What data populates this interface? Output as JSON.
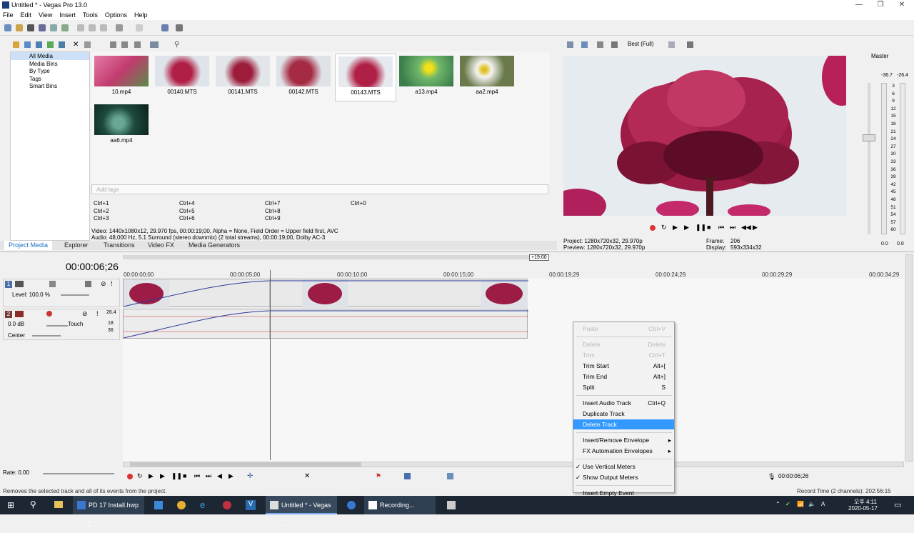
{
  "window": {
    "title": "Untitled * - Vegas Pro 13.0"
  },
  "menu": [
    "File",
    "Edit",
    "View",
    "Insert",
    "Tools",
    "Options",
    "Help"
  ],
  "explorer_tree": [
    "All Media",
    "Media Bins",
    "By Type",
    "Tags",
    "Smart Bins"
  ],
  "media": [
    {
      "name": "10.mp4",
      "color": "#c23b6e"
    },
    {
      "name": "00140.MTS",
      "color": "#a81e3c"
    },
    {
      "name": "00141.MTS",
      "color": "#9c1c3a"
    },
    {
      "name": "00142.MTS",
      "color": "#a52a44"
    },
    {
      "name": "00143.MTS",
      "color": "#b01f45"
    },
    {
      "name": "a13.mp4",
      "color": "#4e9a5a"
    },
    {
      "name": "aa2.mp4",
      "color": "#e8e6d8"
    },
    {
      "name": "aa6.mp4",
      "color": "#1d4a3e"
    }
  ],
  "tags_placeholder": "Add tags",
  "shortcuts": [
    [
      "Ctrl+1",
      "Ctrl+4",
      "Ctrl+7",
      "Ctrl+0"
    ],
    [
      "Ctrl+2",
      "Ctrl+5",
      "Ctrl+8"
    ],
    [
      "Ctrl+3",
      "Ctrl+6",
      "Ctrl+9"
    ]
  ],
  "media_info": {
    "video": "Video: 1440x1080x12, 29.970 fps, 00:00:19;00, Alpha = None, Field Order = Upper field first, AVC",
    "audio": "Audio: 48,000 Hz, 5.1 Surround (stereo downmix) (2 total streams), 00:00:19;00, Dolby AC-3"
  },
  "tabs": [
    "Project Media",
    "Explorer",
    "Transitions",
    "Video FX",
    "Media Generators"
  ],
  "preview": {
    "quality": "Best (Full)",
    "project": "Project:  1280x720x32, 29.970p",
    "preview": "Preview:  1280x720x32, 29.970p",
    "frame_label": "Frame:",
    "frame_value": "206",
    "display_label": "Display:",
    "display_value": "593x334x32"
  },
  "master": {
    "label": "Master",
    "peak_left": "-36.7",
    "peak_right": "-26.4",
    "scale": [
      "3",
      "6",
      "9",
      "12",
      "15",
      "18",
      "21",
      "24",
      "27",
      "30",
      "33",
      "36",
      "39",
      "42",
      "45",
      "48",
      "51",
      "54",
      "57",
      "60"
    ],
    "bottom_left": "0.0",
    "bottom_right": "0.0"
  },
  "timeline": {
    "current_time": "00:00:06;26",
    "end_marker": "+19:00",
    "ruler": [
      "00:00:00;00",
      "00:00:05;00",
      "00:00:10;00",
      "00:00:15;00",
      "00:00:19;29",
      "00:00:24;29",
      "00:00:29;29",
      "00:00:34;29"
    ],
    "video_track": {
      "number": "1",
      "level": "Level: 100.0 %"
    },
    "audio_track": {
      "number": "2",
      "volume": "0.0 dB",
      "pan": "Center",
      "automation": "Touch",
      "meter_top": "26.4",
      "meter_a": "18",
      "meter_b": "36"
    },
    "rate": "Rate: 0.00",
    "end_time": "00:00:06;26"
  },
  "context_menu": [
    {
      "label": "Paste",
      "shortcut": "Ctrl+V",
      "enabled": false
    },
    {
      "sep": true
    },
    {
      "label": "Delete",
      "shortcut": "Delete",
      "enabled": false
    },
    {
      "label": "Trim",
      "shortcut": "Ctrl+T",
      "enabled": false
    },
    {
      "label": "Trim Start",
      "shortcut": "Alt+[",
      "enabled": true
    },
    {
      "label": "Trim End",
      "shortcut": "Alt+]",
      "enabled": true
    },
    {
      "label": "Split",
      "shortcut": "S",
      "enabled": true
    },
    {
      "sep": true
    },
    {
      "label": "Insert Audio Track",
      "shortcut": "Ctrl+Q",
      "enabled": true
    },
    {
      "label": "Duplicate Track",
      "shortcut": "",
      "enabled": true
    },
    {
      "label": "Delete Track",
      "shortcut": "",
      "enabled": true,
      "highlight": true
    },
    {
      "sep": true
    },
    {
      "label": "Insert/Remove Envelope",
      "shortcut": "",
      "enabled": true,
      "submenu": true
    },
    {
      "label": "FX Automation Envelopes",
      "shortcut": "",
      "enabled": true,
      "submenu": true
    },
    {
      "sep": true
    },
    {
      "label": "Use Vertical Meters",
      "shortcut": "",
      "enabled": true,
      "checked": true
    },
    {
      "label": "Show Output Meters",
      "shortcut": "",
      "enabled": true,
      "checked": true
    },
    {
      "sep": true
    },
    {
      "label": "Insert Empty Event",
      "shortcut": "",
      "enabled": true
    }
  ],
  "status": {
    "hint": "Removes the selected track and all of its events from the project.",
    "record": "Record Time (2 channels): 202:56:15"
  },
  "taskbar": {
    "items": [
      "PD 17 Install.hwp [...",
      "Untitled * - Vegas ...",
      "Recording..."
    ],
    "time": "오후 4:11",
    "date": "2020-05-17"
  }
}
